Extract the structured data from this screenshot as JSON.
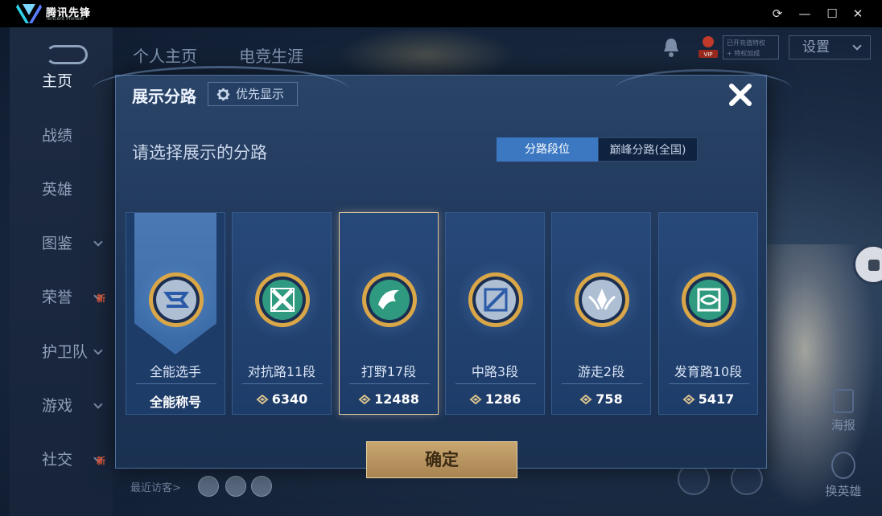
{
  "window": {
    "app_name": "腾讯先锋",
    "app_sub": "Tencent Pioneer",
    "controls": [
      "refresh",
      "minimize",
      "maximize",
      "close"
    ]
  },
  "sidebar": {
    "items": [
      {
        "label": "主页",
        "active": true,
        "chevron": false,
        "new": false
      },
      {
        "label": "战绩",
        "active": false,
        "chevron": false,
        "new": false
      },
      {
        "label": "英雄",
        "active": false,
        "chevron": false,
        "new": false
      },
      {
        "label": "图鉴",
        "active": false,
        "chevron": true,
        "new": false
      },
      {
        "label": "荣誉",
        "active": false,
        "chevron": true,
        "new": true
      },
      {
        "label": "护卫队",
        "active": false,
        "chevron": true,
        "new": false
      },
      {
        "label": "游戏",
        "active": false,
        "chevron": true,
        "new": false
      },
      {
        "label": "社交",
        "active": false,
        "chevron": true,
        "new": true
      }
    ],
    "new_label": "新"
  },
  "topbar": {
    "tabs": [
      "个人主页",
      "电竞生涯"
    ],
    "vip_line1": "已开充值特权",
    "vip_line2": "+ 特权加成",
    "settings": "设置"
  },
  "right_panel": {
    "poster": "海报",
    "swap_hero": "换英雄"
  },
  "bottom": {
    "visitors": "最近访客>"
  },
  "modal": {
    "title": "展示分路",
    "priority_button": "优先显示",
    "subtitle": "请选择展示的分路",
    "segments": [
      "分路段位",
      "巅峰分路(全国)"
    ],
    "active_segment": 0,
    "confirm": "确定",
    "cards": [
      {
        "label": "全能选手",
        "value": "全能称号",
        "badge": "allround-badge",
        "selected": false,
        "show_icon": false
      },
      {
        "label": "对抗路11段",
        "value": "6340",
        "badge": "clash-lane-badge",
        "selected": false,
        "show_icon": true
      },
      {
        "label": "打野17段",
        "value": "12488",
        "badge": "jungle-badge",
        "selected": true,
        "show_icon": true
      },
      {
        "label": "中路3段",
        "value": "1286",
        "badge": "mid-lane-badge",
        "selected": false,
        "show_icon": true
      },
      {
        "label": "游走2段",
        "value": "758",
        "badge": "roam-badge",
        "selected": false,
        "show_icon": true
      },
      {
        "label": "发育路10段",
        "value": "5417",
        "badge": "farm-lane-badge",
        "selected": false,
        "show_icon": true
      }
    ]
  },
  "colors": {
    "accent_blue": "#3c78c2",
    "gold": "#c9a771",
    "green_badge": "#2f9a7f",
    "silver_badge": "#a9b9cf"
  }
}
